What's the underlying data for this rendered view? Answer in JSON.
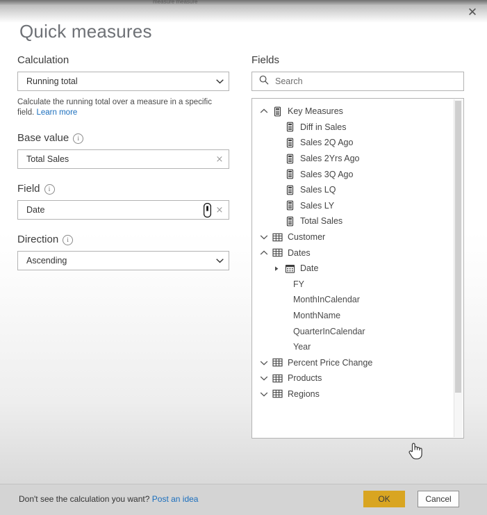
{
  "window": {
    "behind_title": "measure measure",
    "close_label": "✕"
  },
  "title": "Quick measures",
  "left": {
    "calculation": {
      "label": "Calculation",
      "value": "Running total",
      "description": "Calculate the running total over a measure in a specific field.",
      "learn_more": "Learn more"
    },
    "base_value": {
      "label": "Base value",
      "value": "Total Sales",
      "clear": "×"
    },
    "field": {
      "label": "Field",
      "value": "Date",
      "clear": "×"
    },
    "direction": {
      "label": "Direction",
      "value": "Ascending"
    }
  },
  "right": {
    "label": "Fields",
    "search": {
      "placeholder": "Search",
      "value": ""
    },
    "tree": [
      {
        "label": "Key Measures",
        "level": "table",
        "icon": "measure-group-icon",
        "twisty": "expanded"
      },
      {
        "label": "Diff in Sales",
        "level": "measure",
        "icon": "measure-icon",
        "twisty": "none"
      },
      {
        "label": "Sales 2Q Ago",
        "level": "measure",
        "icon": "measure-icon",
        "twisty": "none"
      },
      {
        "label": "Sales 2Yrs Ago",
        "level": "measure",
        "icon": "measure-icon",
        "twisty": "none"
      },
      {
        "label": "Sales 3Q Ago",
        "level": "measure",
        "icon": "measure-icon",
        "twisty": "none"
      },
      {
        "label": "Sales LQ",
        "level": "measure",
        "icon": "measure-icon",
        "twisty": "none"
      },
      {
        "label": "Sales LY",
        "level": "measure",
        "icon": "measure-icon",
        "twisty": "none"
      },
      {
        "label": "Total Sales",
        "level": "measure",
        "icon": "measure-icon",
        "twisty": "none"
      },
      {
        "label": "Customer",
        "level": "table",
        "icon": "table-icon",
        "twisty": "collapsed"
      },
      {
        "label": "Dates",
        "level": "table",
        "icon": "table-icon",
        "twisty": "expanded"
      },
      {
        "label": "Date",
        "level": "column",
        "icon": "calendar-icon",
        "twisty": "leaf-collapsed"
      },
      {
        "label": "FY",
        "level": "plain",
        "icon": "none",
        "twisty": "none"
      },
      {
        "label": "MonthInCalendar",
        "level": "plain",
        "icon": "none",
        "twisty": "none"
      },
      {
        "label": "MonthName",
        "level": "plain",
        "icon": "none",
        "twisty": "none"
      },
      {
        "label": "QuarterInCalendar",
        "level": "plain",
        "icon": "none",
        "twisty": "none"
      },
      {
        "label": "Year",
        "level": "plain",
        "icon": "none",
        "twisty": "none"
      },
      {
        "label": "Percent Price Change",
        "level": "table",
        "icon": "table-icon",
        "twisty": "collapsed"
      },
      {
        "label": "Products",
        "level": "table",
        "icon": "table-icon",
        "twisty": "collapsed"
      },
      {
        "label": "Regions",
        "level": "table",
        "icon": "table-icon",
        "twisty": "collapsed"
      }
    ]
  },
  "footer": {
    "hint_text": "Don't see the calculation you want?",
    "hint_link": "Post an idea",
    "ok_label": "OK",
    "cancel_label": "Cancel"
  },
  "colors": {
    "accent_ok": "#D9A521",
    "link": "#1a6ebd",
    "footer_bg": "#d4d4d4",
    "title_text": "#6e7176"
  }
}
